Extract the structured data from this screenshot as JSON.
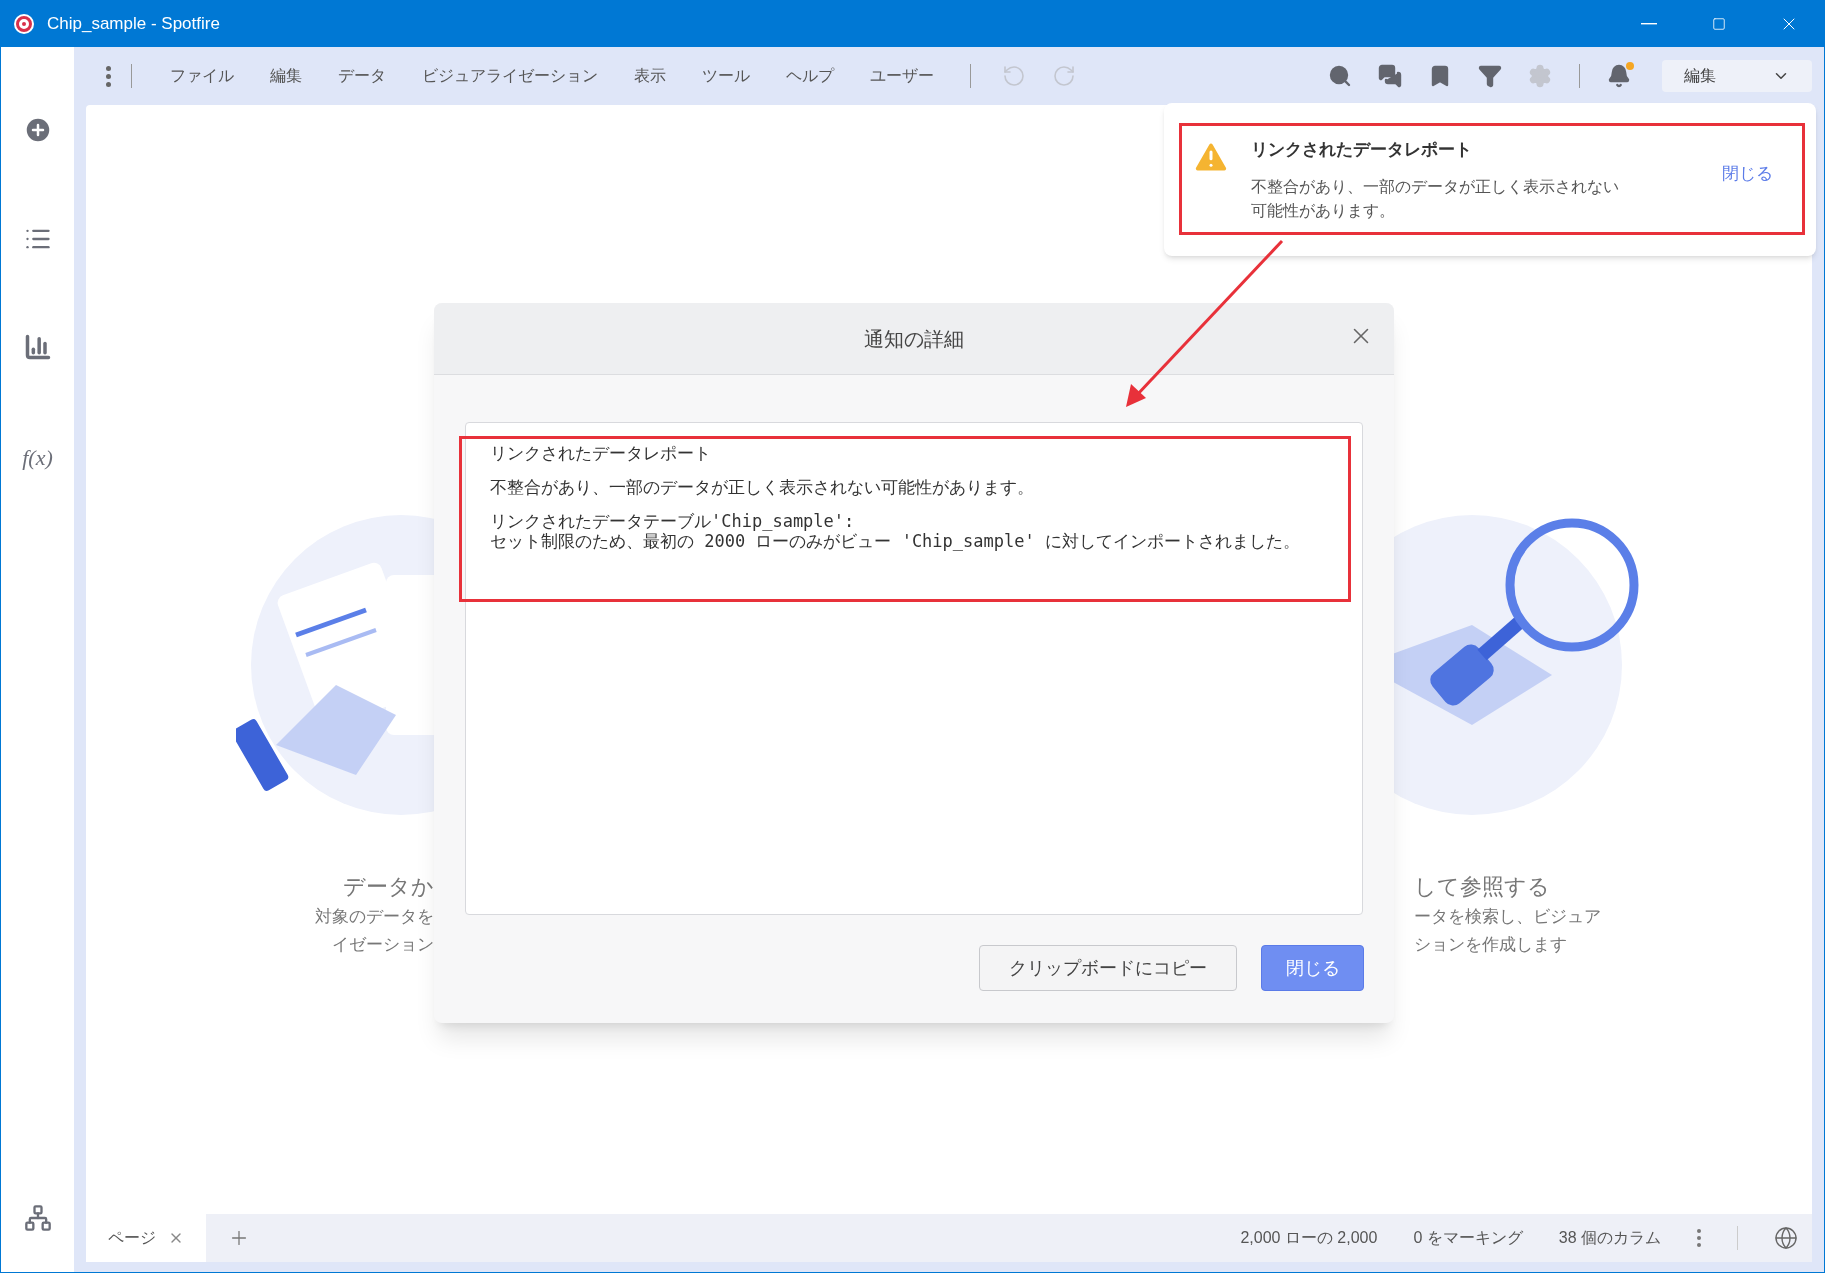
{
  "window": {
    "title": "Chip_sample - Spotfire"
  },
  "sidebar": {
    "function_label": "f(x)"
  },
  "menu": [
    "ファイル",
    "編集",
    "データ",
    "ビジュアライゼーション",
    "表示",
    "ツール",
    "ヘルプ",
    "ユーザー"
  ],
  "toolbar": [
    {
      "kind": "undo",
      "disabled": true
    },
    {
      "kind": "redo",
      "disabled": true
    },
    {
      "kind": "search",
      "disabled": false
    },
    {
      "kind": "comments",
      "disabled": false
    },
    {
      "kind": "bookmark",
      "disabled": false
    },
    {
      "kind": "filter",
      "disabled": false
    },
    {
      "kind": "settings",
      "disabled": true
    },
    {
      "kind": "notifications",
      "disabled": false,
      "badge": true
    }
  ],
  "mode_dropdown": {
    "value": "編集"
  },
  "background": {
    "left": {
      "heading": "データか",
      "lines": [
        "対象のデータを",
        "イゼーション"
      ]
    },
    "right": {
      "heading": "して参照する",
      "lines": [
        "ータを検索し、ビジュア",
        "ションを作成します"
      ]
    }
  },
  "notification": {
    "title": "リンクされたデータレポート",
    "message": "不整合があり、一部のデータが正しく表示されない可能性があります。",
    "close_label": "閉じる"
  },
  "dialog": {
    "title": "通知の詳細",
    "paragraphs": [
      [
        "リンクされたデータレポート"
      ],
      [
        "不整合があり、一部のデータが正しく表示されない可能性があります。"
      ],
      [
        "リンクされたデータテーブル'Chip_sample':",
        "セット制限のため、最初の 2000 ローのみがビュー 'Chip_sample' に対してインポートされました。"
      ]
    ],
    "buttons": [
      {
        "label": "クリップボードにコピー",
        "primary": false
      },
      {
        "label": "閉じる",
        "primary": true
      }
    ]
  },
  "status_bar": {
    "page_tabs": [
      {
        "label": "ページ",
        "selected": true
      }
    ],
    "items": [
      "2,000 ローの 2,000",
      "0 をマーキング",
      "38 個のカラム"
    ]
  }
}
